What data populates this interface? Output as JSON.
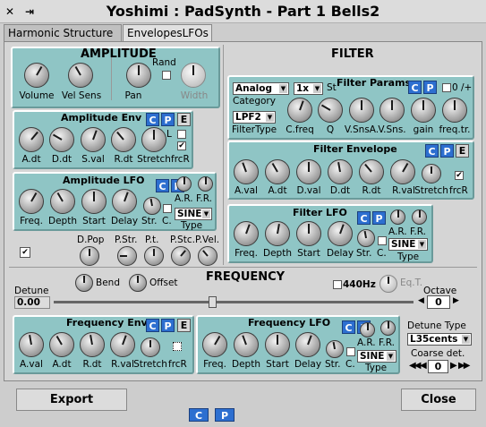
{
  "window": {
    "title": "Yoshimi : PadSynth - Part 1 Bells2",
    "close_glyph": "✕",
    "pin_glyph": "⇥"
  },
  "tabs": [
    {
      "label": "Harmonic Structure"
    },
    {
      "label": "EnvelopesLFOs"
    }
  ],
  "amplitude": {
    "title": "AMPLITUDE",
    "volume": "Volume",
    "vel_sens": "Vel Sens",
    "pan": "Pan",
    "rand": "Rand",
    "width": "Width"
  },
  "amp_env": {
    "title": "Amplitude Env",
    "c": "C",
    "p": "P",
    "e": "E",
    "l": "L",
    "labels": [
      "A.dt",
      "D.dt",
      "S.val",
      "R.dt",
      "Stretch"
    ],
    "frcr": "frcR"
  },
  "amp_lfo": {
    "title": "Amplitude LFO",
    "c": "C",
    "p": "P",
    "labels": [
      "Freq.",
      "Depth",
      "Start",
      "Delay"
    ],
    "str": "Str.",
    "c2": "C.",
    "ar": "A.R.",
    "fr": "F.R.",
    "type_value": "SINE",
    "type_label": "Type"
  },
  "misc": {
    "labels": [
      "D.Pop",
      "P.Str.",
      "P.t.",
      "P.Stc.",
      "P.Vel."
    ]
  },
  "filter": {
    "title": "FILTER",
    "params_title": "Filter Params",
    "analog": "Analog",
    "mult": "1x",
    "st": "St",
    "category": "Category",
    "c": "C",
    "p": "P",
    "plus": "0 /+",
    "filtertype_value": "LPF2",
    "filtertype_label": "FilterType",
    "labels": [
      "C.freq",
      "Q",
      "V.SnsA.",
      "V.Sns.",
      "gain",
      "freq.tr."
    ]
  },
  "filter_env": {
    "title": "Filter Envelope",
    "c": "C",
    "p": "P",
    "e": "E",
    "labels": [
      "A.val",
      "A.dt",
      "D.val",
      "D.dt",
      "R.dt",
      "R.val",
      "Stretch"
    ],
    "frcr": "frcR"
  },
  "filter_lfo": {
    "title": "Filter LFO",
    "c": "C",
    "p": "P",
    "labels": [
      "Freq.",
      "Depth",
      "Start",
      "Delay"
    ],
    "str": "Str.",
    "c2": "C.",
    "ar": "A.R.",
    "fr": "F.R.",
    "type_value": "SINE",
    "type_label": "Type"
  },
  "frequency": {
    "title": "FREQUENCY",
    "bend": "Bend",
    "offset": "Offset",
    "hz440": "440Hz",
    "eqt": "Eq.T.",
    "detune": "Detune",
    "detune_value": "0.00",
    "octave": "Octave",
    "octave_value": "0",
    "detune_type": "Detune Type",
    "detune_type_value": "L35cents",
    "coarse": "Coarse det.",
    "coarse_value": "0",
    "detune_fraction": 0.44
  },
  "freq_env": {
    "title": "Frequency Env",
    "c": "C",
    "p": "P",
    "e": "E",
    "labels": [
      "A.val",
      "A.dt",
      "R.dt",
      "R.val",
      "Stretch"
    ],
    "frcr": "frcR"
  },
  "freq_lfo": {
    "title": "Frequency LFO",
    "c": "C",
    "p": "P",
    "labels": [
      "Freq.",
      "Depth",
      "Start",
      "Delay"
    ],
    "str": "Str.",
    "c2": "C.",
    "ar": "A.R.",
    "fr": "F.R.",
    "type_value": "SINE",
    "type_label": "Type"
  },
  "footer": {
    "export": "Export",
    "close": "Close",
    "c": "C",
    "p": "P"
  },
  "colors": {
    "panel": "#8fc5c5",
    "accent": "#2d6fd0"
  }
}
